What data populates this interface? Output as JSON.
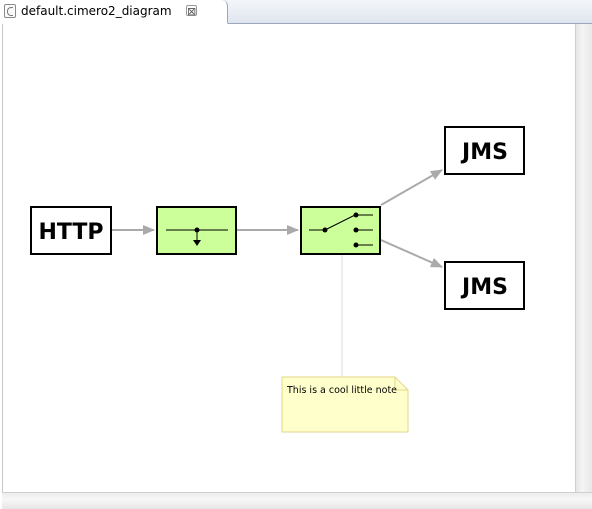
{
  "tab": {
    "title": "default.cimero2_diagram",
    "close_glyph": "⊠",
    "icon": "cimero-file-icon"
  },
  "diagram": {
    "nodes": {
      "http": "HTTP",
      "jms_top": "JMS",
      "jms_bottom": "JMS",
      "filter": "",
      "router": ""
    },
    "note": {
      "text": "This is a cool little note"
    },
    "colors": {
      "processor_fill": "#ccff99",
      "edge": "#aaaaaa",
      "note_fill": "#ffffcc",
      "note_border": "#e6d68a"
    }
  }
}
